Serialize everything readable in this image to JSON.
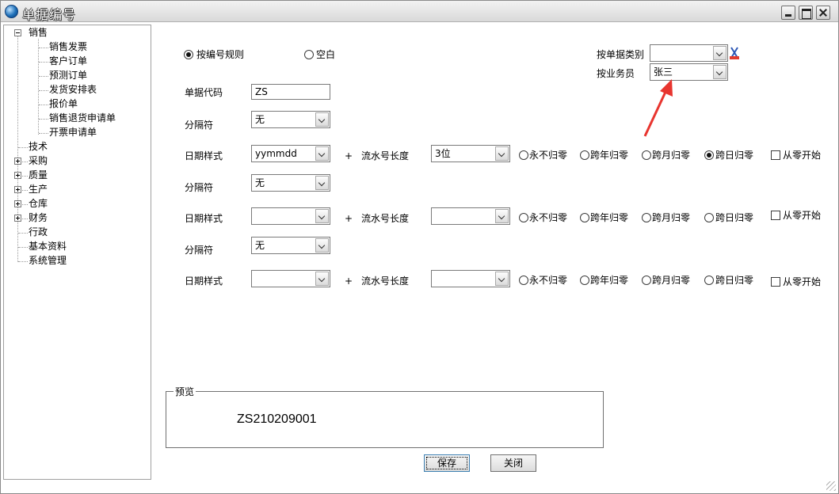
{
  "window": {
    "title": "单据编号"
  },
  "tree": {
    "sales": {
      "label": "销售",
      "children": [
        "销售发票",
        "客户订单",
        "预测订单",
        "发货安排表",
        "报价单",
        "销售退货申请单",
        "开票申请单"
      ]
    },
    "others": [
      "技术",
      "采购",
      "质量",
      "生产",
      "仓库",
      "财务",
      "行政",
      "基本资料",
      "系统管理"
    ]
  },
  "form": {
    "mode_rule_label": "按编号规则",
    "mode_blank_label": "空白",
    "doc_type_label": "按单据类别",
    "doc_type_value": "",
    "salesman_label": "按业务员",
    "salesman_value": "张三",
    "code_label": "单据代码",
    "code_value": "ZS",
    "separator_label": "分隔符",
    "date_style_label": "日期样式",
    "plus": "+",
    "serial_length_label": "流水号长度",
    "reset_options": [
      "永不归零",
      "跨年归零",
      "跨月归零",
      "跨日归零"
    ],
    "zero_start_label": "从零开始",
    "segments": [
      {
        "separator": "无",
        "date_style": "yymmdd",
        "serial_length": "3位",
        "reset_selected": 3
      },
      {
        "separator": "无",
        "date_style": "",
        "serial_length": "",
        "reset_selected": -1
      },
      {
        "separator": "无",
        "date_style": "",
        "serial_length": "",
        "reset_selected": -1
      }
    ]
  },
  "preview": {
    "legend": "预览",
    "value": "ZS210209001"
  },
  "buttons": {
    "save": "保存",
    "close": "关闭"
  },
  "colors": {
    "annotation_arrow": "#e8352f"
  }
}
